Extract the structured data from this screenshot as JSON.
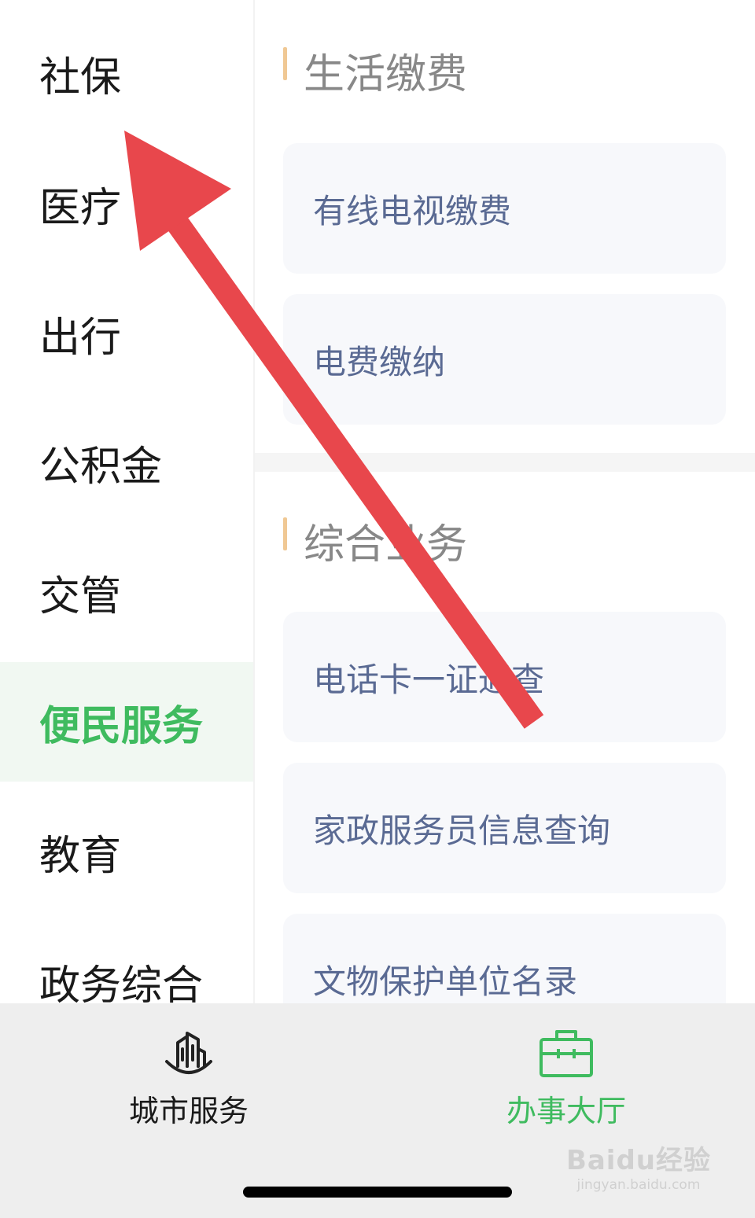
{
  "sidebar": {
    "items": [
      {
        "label": "社保"
      },
      {
        "label": "医疗"
      },
      {
        "label": "出行"
      },
      {
        "label": "公积金"
      },
      {
        "label": "交管"
      },
      {
        "label": "便民服务",
        "active": true
      },
      {
        "label": "教育"
      },
      {
        "label": "政务综合"
      }
    ]
  },
  "main": {
    "sections": [
      {
        "title": "生活缴费",
        "items": [
          "有线电视缴费",
          "电费缴纳"
        ]
      },
      {
        "title": "综合业务",
        "items": [
          "电话卡一证通查",
          "家政服务员信息查询",
          "文物保护单位名录"
        ]
      }
    ]
  },
  "tabbar": {
    "tabs": [
      {
        "label": "城市服务",
        "icon": "city-buildings-icon"
      },
      {
        "label": "办事大厅",
        "icon": "briefcase-icon",
        "active": true
      }
    ]
  },
  "watermark": {
    "main": "Baidu经验",
    "sub": "jingyan.baidu.com"
  },
  "colors": {
    "accent": "#3fbb5f",
    "arrow": "#e8474c",
    "card_text": "#5a6a93",
    "section_bar": "#f0c894"
  }
}
